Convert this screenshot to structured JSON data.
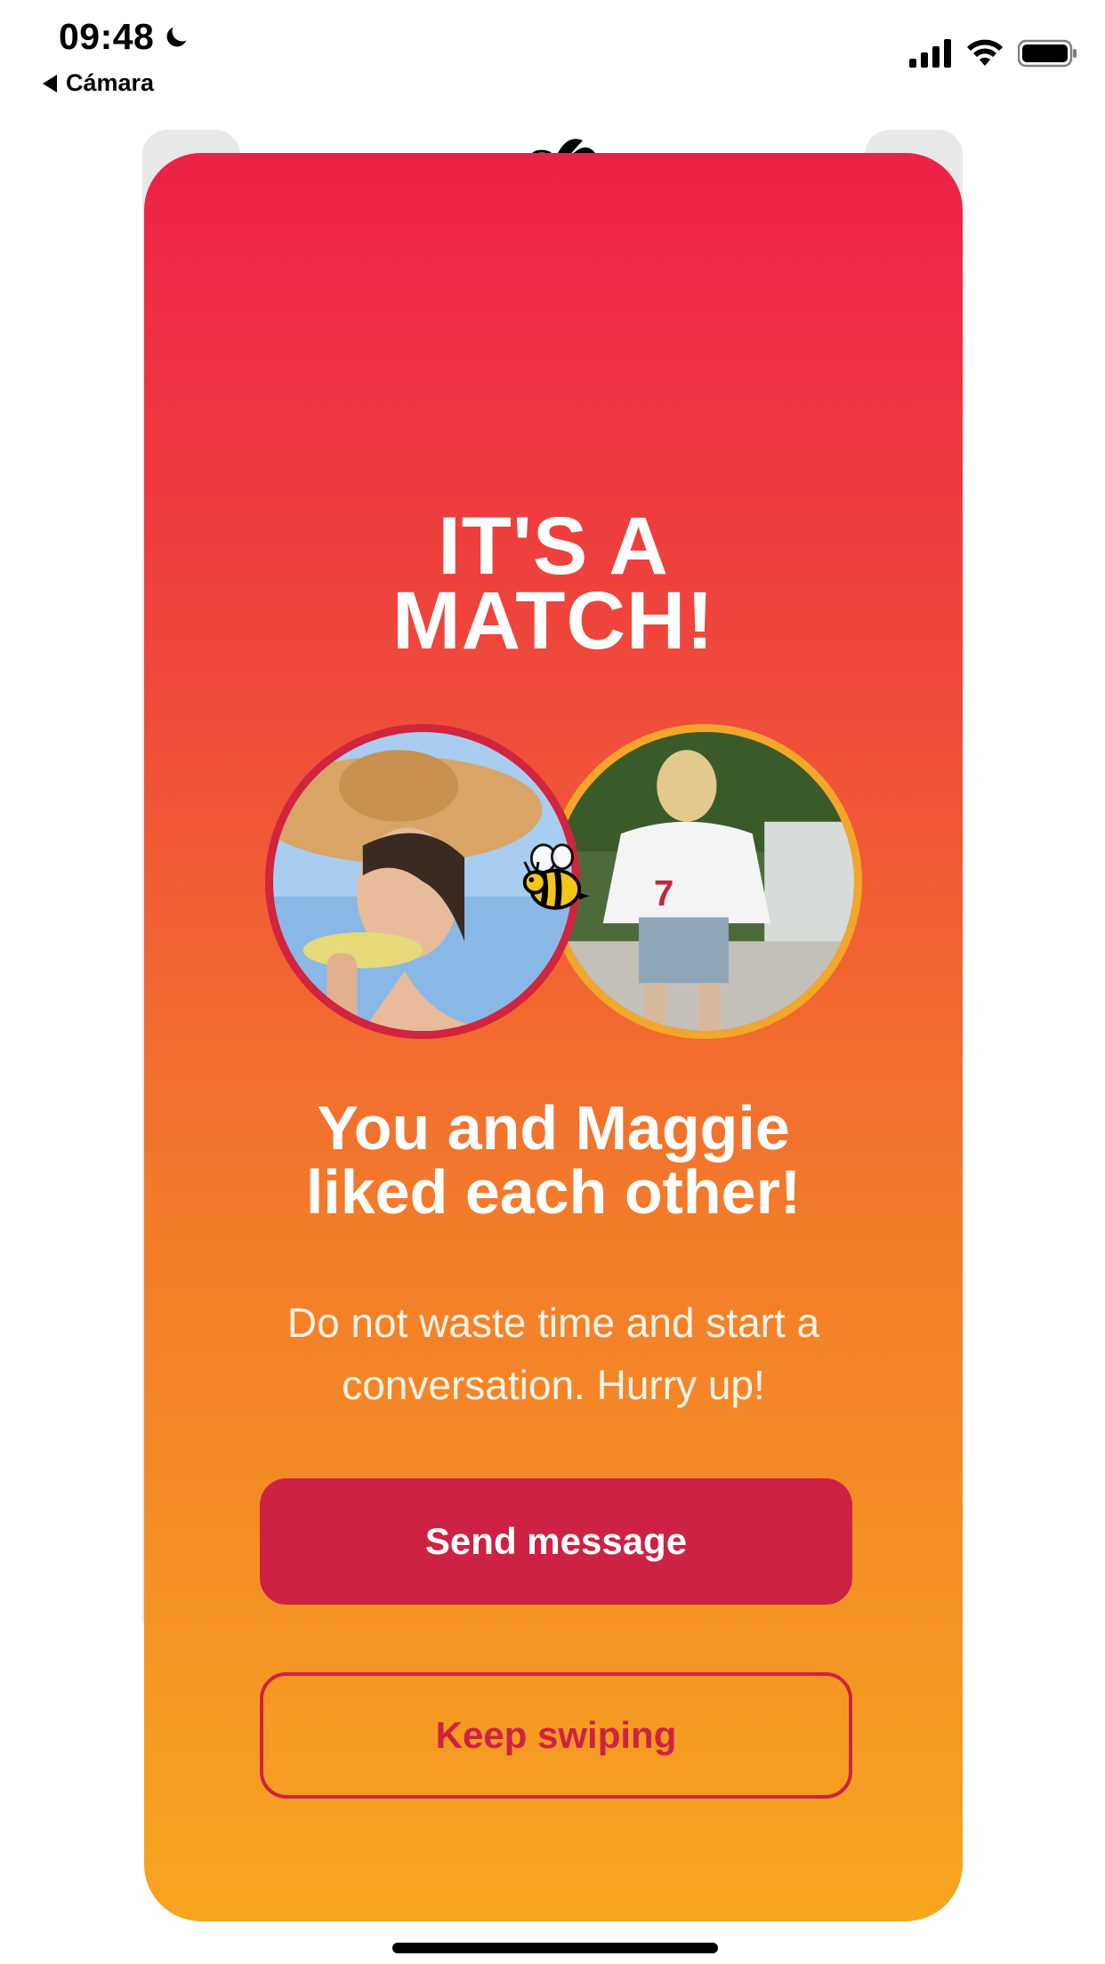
{
  "status_bar": {
    "time": "09:48",
    "back_app": "Cámara",
    "icons": [
      "moon-icon",
      "signal-icon",
      "wifi-icon",
      "battery-icon"
    ]
  },
  "match": {
    "title_line1": "IT'S A",
    "title_line2": "MATCH!",
    "subtitle_line1": "You and Maggie",
    "subtitle_line2": "liked each other!",
    "description_line1": "Do not waste time and start a",
    "description_line2": "conversation. Hurry up!",
    "primary_button": "Send message",
    "secondary_button": "Keep swiping",
    "photos": [
      "user-photo",
      "maggie-photo"
    ],
    "decor_icon": "bee-icon"
  },
  "colors": {
    "gradient_top": "#ed2147",
    "gradient_bottom": "#f7a51f",
    "button_primary": "#cd2244",
    "left_ring": "#d0243f",
    "right_ring": "#f2a72a",
    "text": "#ffffff"
  }
}
